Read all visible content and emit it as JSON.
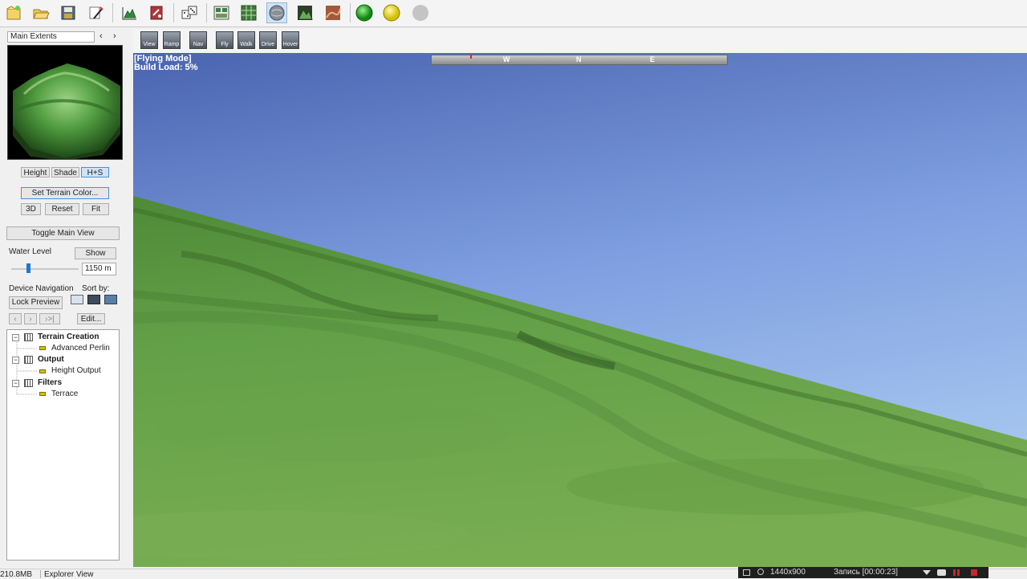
{
  "toolbar": {
    "buttons": [
      {
        "name": "new-project-icon"
      },
      {
        "name": "open-project-icon"
      },
      {
        "name": "save-project-icon"
      },
      {
        "name": "wizard-icon"
      },
      {
        "name": "terrain-icon"
      },
      {
        "name": "settings-icon"
      },
      {
        "name": "randomize-icon"
      },
      {
        "name": "view-panels-icon"
      },
      {
        "name": "grid-view-icon"
      },
      {
        "name": "globe-view-icon"
      },
      {
        "name": "mountain-view-icon"
      },
      {
        "name": "texture-view-icon"
      },
      {
        "name": "green-status-icon",
        "color": "#1fa31f"
      },
      {
        "name": "yellow-status-icon",
        "color": "#e3cf00"
      },
      {
        "name": "gray-status-icon",
        "color": "#bdbdbd"
      }
    ]
  },
  "nav_modes": [
    {
      "label": "View"
    },
    {
      "label": "Ramp"
    },
    {
      "label": "Nav"
    },
    {
      "label": "Fly"
    },
    {
      "label": "Walk"
    },
    {
      "label": "Drive"
    },
    {
      "label": "Hover"
    }
  ],
  "left_panel": {
    "extents_select": "Main Extents",
    "prev_arrow": "‹",
    "next_arrow": "›",
    "preview_modes": {
      "height": "Height",
      "shade": "Shade",
      "hs": "H+S"
    },
    "set_terrain_color": "Set Terrain Color...",
    "btn_3d": "3D",
    "btn_reset": "Reset",
    "btn_fit": "Fit",
    "toggle_main_view": "Toggle Main View",
    "water_level_label": "Water Level",
    "show_button": "Show",
    "water_level_value": "1150 m",
    "water_level_fraction": 0.25,
    "device_navigation_label": "Device Navigation",
    "sort_by_label": "Sort by:",
    "lock_preview": "Lock Preview",
    "nav_back": "‹",
    "nav_forward": "›",
    "nav_end": "›>|",
    "edit_button": "Edit..."
  },
  "tree": {
    "groups": [
      {
        "label": "Terrain Creation",
        "children": [
          "Advanced Perlin"
        ]
      },
      {
        "label": "Output",
        "children": [
          "Height Output"
        ]
      },
      {
        "label": "Filters",
        "children": [
          "Terrace"
        ]
      }
    ]
  },
  "viewport": {
    "mode": "[Flying Mode]",
    "build_load": "Build Load: 5%",
    "compass": {
      "w": "W",
      "n": "N",
      "e": "E"
    }
  },
  "statusbar": {
    "memory": "210.8MB",
    "view": "Explorer View"
  },
  "recorder": {
    "resolution": "1440x900",
    "recording": "Запись [00:00:23]"
  },
  "colors": {
    "sky_top": "#4a64b0",
    "sky_bottom": "#a8c8f0",
    "terrain": "#5a9a3c"
  }
}
